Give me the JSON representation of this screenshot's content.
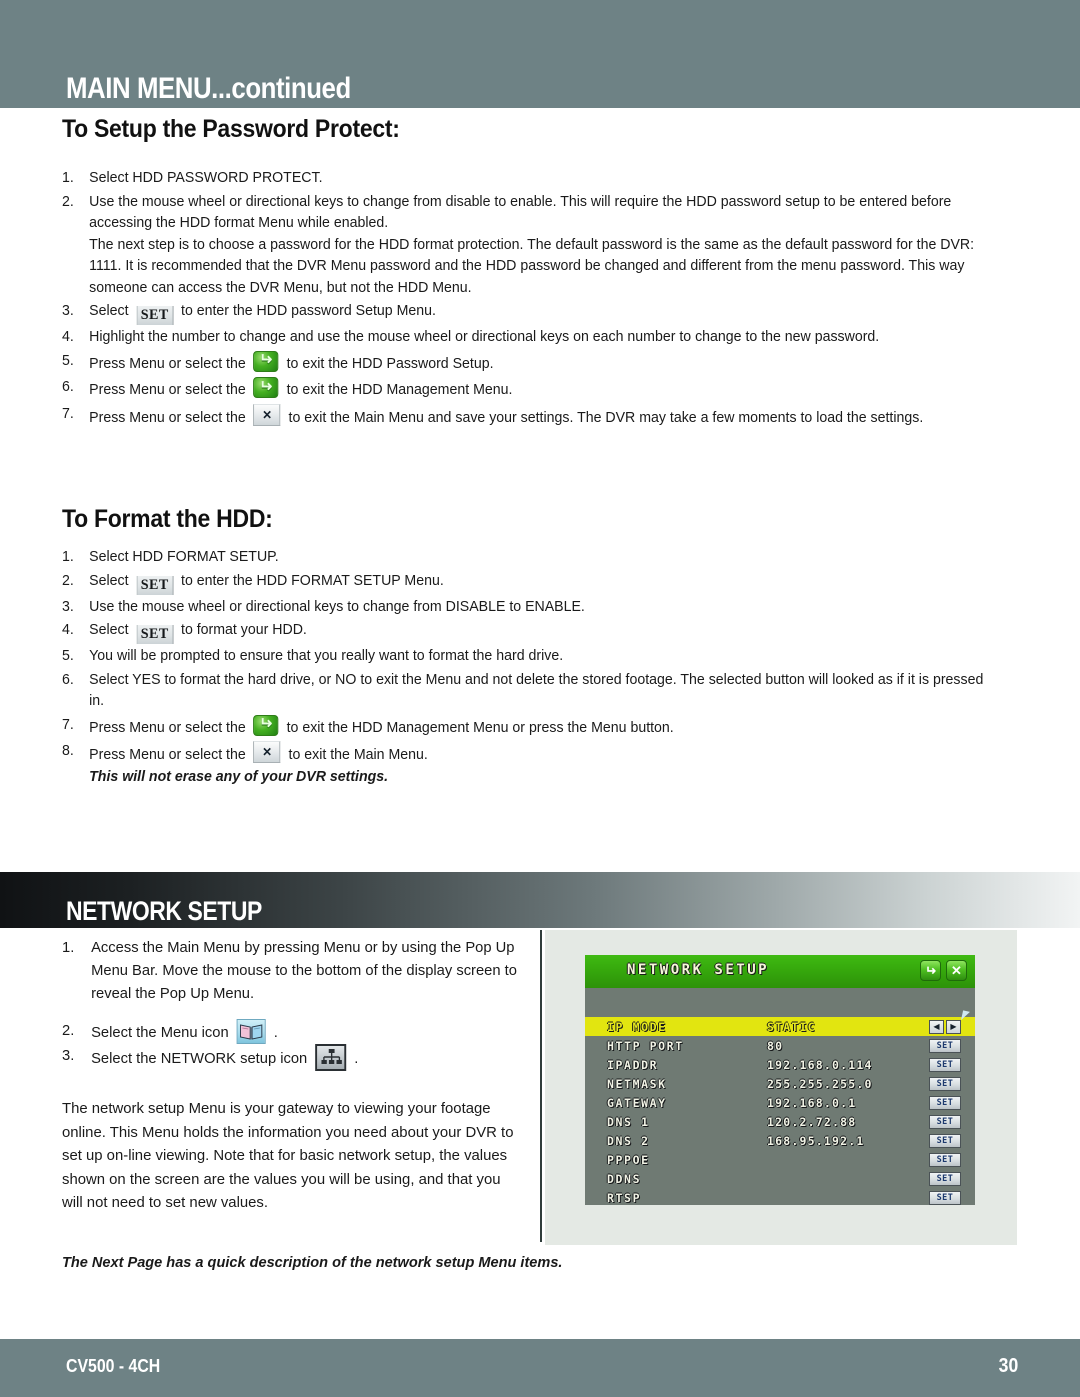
{
  "header": {
    "title": "MAIN MENU...continued",
    "band_color": "#6e8285"
  },
  "sections": {
    "password": {
      "heading": "To Setup the Password Protect:",
      "items": [
        {
          "num": "1.",
          "text": "Select HDD PASSWORD PROTECT."
        },
        {
          "num": "2.",
          "text": "Use the mouse wheel or directional keys to change from disable to enable. This will require the HDD password setup to be entered before accessing the HDD format Menu while enabled.",
          "sub": "The next step is to choose a password for the HDD format protection. The default password is the same as the default password for the DVR: 1111. It is recommended that the DVR Menu password and the HDD password be changed and different from the menu password. This way someone can access the DVR Menu, but not the HDD Menu."
        },
        {
          "num": "3.",
          "pre": "Select",
          "icon": "set-button",
          "icon_label": "SET",
          "post": "to enter the HDD password Setup Menu."
        },
        {
          "num": "4.",
          "text": "Highlight the number to change and use the mouse wheel or directional keys on each number to change to the new password."
        },
        {
          "num": "5.",
          "pre": "Press Menu or select the",
          "icon": "return-icon",
          "post": "to exit the HDD Password Setup."
        },
        {
          "num": "6.",
          "pre": "Press Menu or select the",
          "icon": "return-icon",
          "post": "to exit the HDD Management Menu."
        },
        {
          "num": "7.",
          "pre": "Press Menu or select the",
          "icon": "close-icon",
          "post": "to exit the Main Menu and save your settings. The DVR may take a few moments to load the settings."
        }
      ]
    },
    "format": {
      "heading": "To Format the HDD:",
      "items": [
        {
          "num": "1.",
          "text": "Select HDD FORMAT SETUP."
        },
        {
          "num": "2.",
          "pre": "Select",
          "icon": "set-button",
          "icon_label": "SET",
          "post": "to enter the HDD FORMAT SETUP Menu."
        },
        {
          "num": "3.",
          "text": "Use the mouse wheel or directional keys to change from DISABLE to ENABLE."
        },
        {
          "num": "4.",
          "pre": "Select",
          "icon": "set-button",
          "icon_label": "SET",
          "post": "to format your HDD."
        },
        {
          "num": "5.",
          "text": "You will be prompted to ensure that you really want to format the hard drive."
        },
        {
          "num": "6.",
          "text": "Select YES to format the hard drive, or NO to exit the Menu and not delete the stored footage. The selected button will looked as if it is pressed in."
        },
        {
          "num": "7.",
          "pre": "Press Menu or select the",
          "icon": "return-icon",
          "post": "to exit the HDD Management Menu or press the Menu button."
        },
        {
          "num": "8.",
          "pre": "Press Menu or select the",
          "icon": "close-icon",
          "post": "to exit the Main Menu.",
          "note": "This will not erase any of your DVR settings."
        }
      ]
    }
  },
  "banner": {
    "title": "NETWORK SETUP"
  },
  "network_section": {
    "items": [
      {
        "num": "1.",
        "text": "Access the Main Menu by pressing Menu or by using the Pop Up Menu Bar. Move the mouse to the bottom of the display screen to reveal the Pop Up Menu."
      },
      {
        "num": "2.",
        "pre": "Select the Menu icon",
        "icon": "menu-book-icon",
        "post": "."
      },
      {
        "num": "3.",
        "pre": "Select the NETWORK setup icon",
        "icon": "network-tree-icon",
        "post": "."
      }
    ],
    "paragraph": "The network setup Menu is your gateway to viewing your footage online. This Menu holds the information you need about your DVR to set up on-line viewing. Note that for basic network setup, the values shown on the screen are the values you will be using, and that you will not need to set new values.",
    "closing_note": "The Next Page has a quick description of the network setup Menu items."
  },
  "dvr_screen": {
    "title": "NETWORK SETUP",
    "titlebar_return_glyph": "↵",
    "titlebar_close_glyph": "✕",
    "arrow_left_glyph": "◀",
    "arrow_right_glyph": "▶",
    "rows": [
      {
        "label": "IP MODE",
        "value": "STATIC",
        "control": "arrows",
        "selected": true
      },
      {
        "label": "HTTP PORT",
        "value": "80",
        "control": "SET",
        "selected": false
      },
      {
        "label": "IPADDR",
        "value": "192.168.0.114",
        "control": "SET",
        "selected": false
      },
      {
        "label": "NETMASK",
        "value": "255.255.255.0",
        "control": "SET",
        "selected": false
      },
      {
        "label": "GATEWAY",
        "value": "192.168.0.1",
        "control": "SET",
        "selected": false
      },
      {
        "label": "DNS 1",
        "value": "120.2.72.88",
        "control": "SET",
        "selected": false
      },
      {
        "label": "DNS 2",
        "value": "168.95.192.1",
        "control": "SET",
        "selected": false
      },
      {
        "label": "PPPOE",
        "value": "",
        "control": "SET",
        "selected": false
      },
      {
        "label": "DDNS",
        "value": "",
        "control": "SET",
        "selected": false
      },
      {
        "label": "RTSP",
        "value": "",
        "control": "SET",
        "selected": false
      }
    ],
    "colors": {
      "titlebar": "#35a60c",
      "body": "#6f7a73",
      "highlight": "#e2e510"
    }
  },
  "footer": {
    "model": "CV500 - 4CH",
    "page": "30"
  }
}
